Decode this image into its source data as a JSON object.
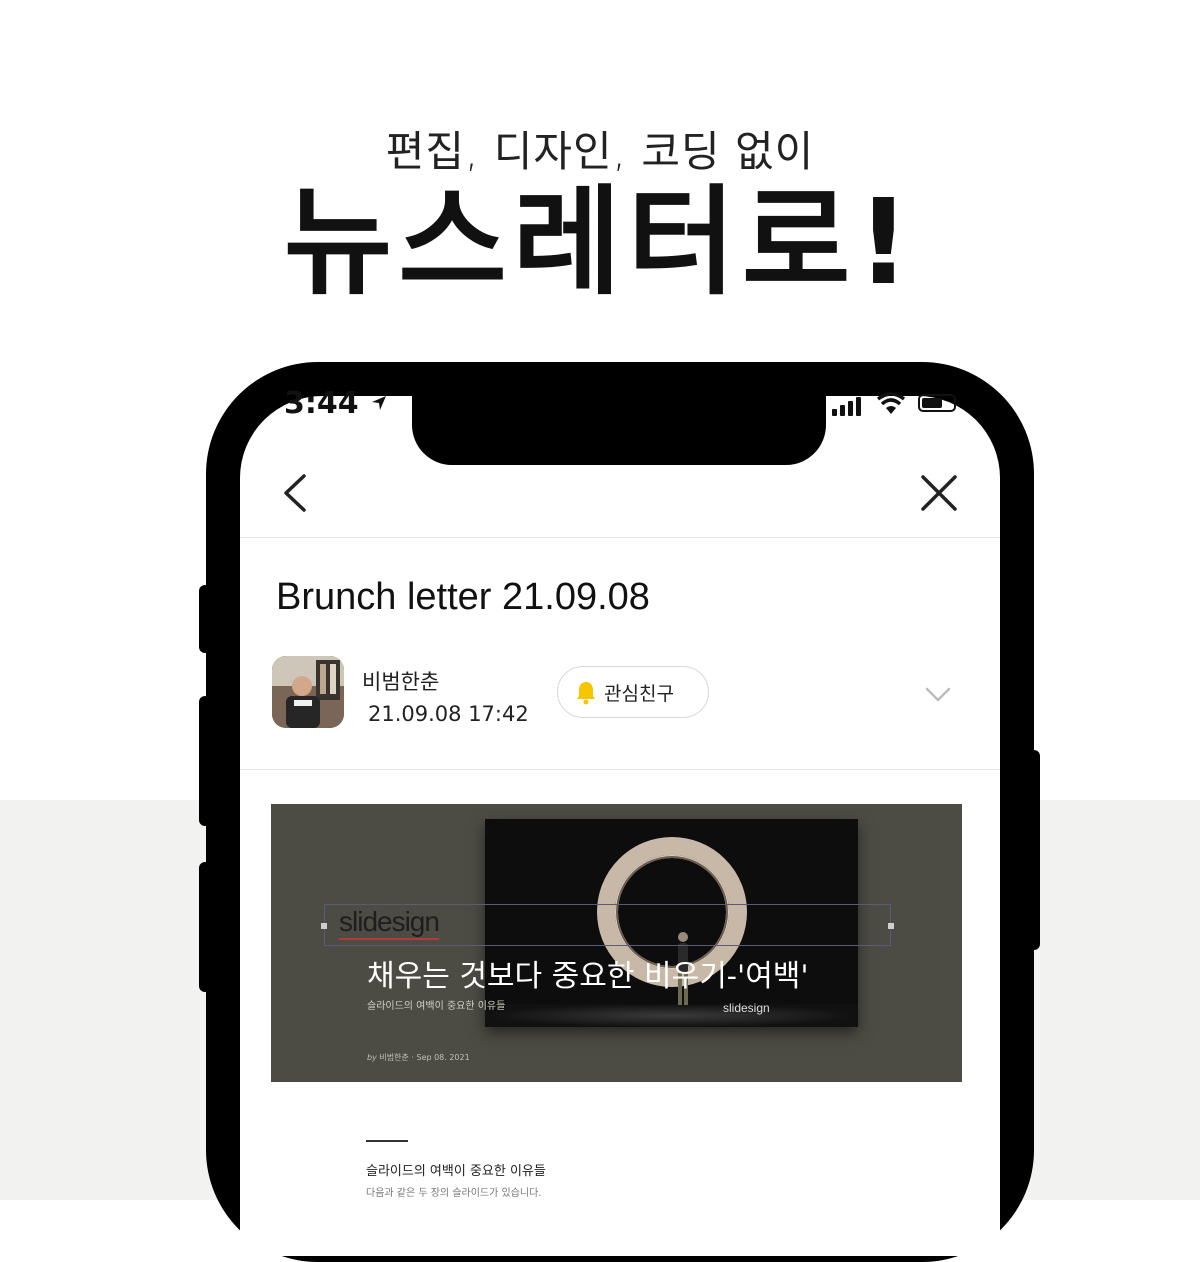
{
  "headline": {
    "subtitle": "편집, 디자인, 코딩 없이",
    "title": "뉴스레터로!"
  },
  "status_bar": {
    "time": "3:44",
    "location_icon": "location-arrow-icon",
    "signal_icon": "cellular-signal-icon",
    "wifi_icon": "wifi-icon",
    "battery_icon": "battery-icon"
  },
  "nav": {
    "back_icon": "chevron-left-icon",
    "close_icon": "close-icon"
  },
  "letter": {
    "title": "Brunch letter 21.09.08",
    "author": "비범한춘",
    "date": "21.09.08 17:42",
    "follow_label": "관심친구",
    "follow_icon": "bell-icon",
    "follow_icon_color": "#f7c600",
    "expand_icon": "chevron-down-icon"
  },
  "card": {
    "logo": "slidesign",
    "title": "채우는 것보다 중요한 비우기-'여백'",
    "subtitle": "슬라이드의 여백이 중요한 이유들",
    "byline_by": "by",
    "byline_author": "비범한춘",
    "byline_date": "Sep 08. 2021",
    "video_logo": "slidesign",
    "background_color": "#4d4c44"
  },
  "body": {
    "heading": "슬라이드의 여백이 중요한 이유들",
    "text": "다음과 같은 두 장의 슬라이드가 있습니다."
  }
}
